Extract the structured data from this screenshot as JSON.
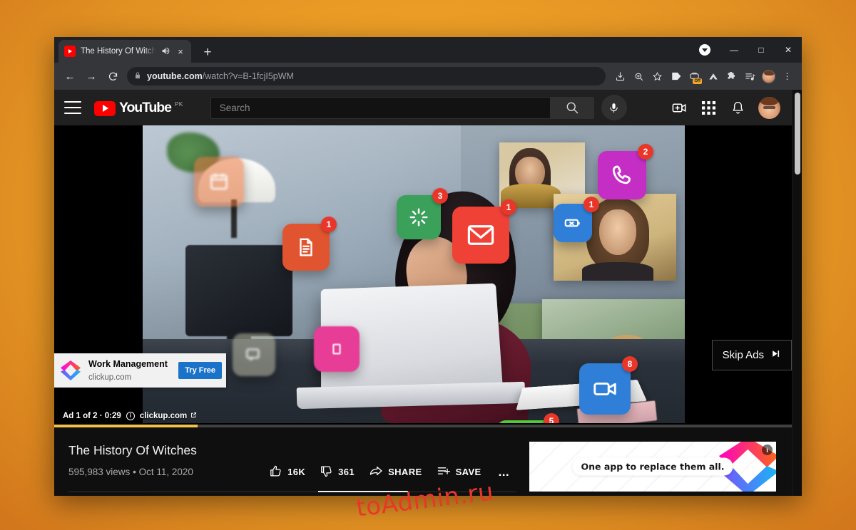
{
  "browser": {
    "tab": {
      "title": "The History Of Witches - You",
      "favicon": "youtube-favicon",
      "mute_icon": "speaker-icon",
      "close_icon": "×"
    },
    "new_tab_label": "+",
    "window_controls": {
      "minimize": "—",
      "maximize": "□",
      "close": "✕"
    },
    "update_indicator": "update-arrow",
    "nav": {
      "back": "←",
      "forward": "→",
      "reload": "⟳"
    },
    "omnibox": {
      "lock_icon": "lock-icon",
      "url_domain": "youtube.com",
      "url_path": "/watch?v=B-1fcjI5pWM"
    },
    "toolbar_icons": [
      "install-app-icon",
      "zoom-icon",
      "bookmark-star-icon",
      "tag-extension-icon",
      "adblock-off-icon",
      "nordvpn-icon",
      "puzzle-extensions-icon",
      "playlist-icon",
      "profile-avatar"
    ],
    "overflow_menu": "⋮"
  },
  "youtube": {
    "masthead": {
      "menu_icon": "hamburger-icon",
      "logo_word": "YouTube",
      "logo_country": "PK",
      "search_placeholder": "Search",
      "search_icon": "search-icon",
      "mic_icon": "microphone-icon",
      "create_icon": "create-video-icon",
      "apps_icon": "youtube-apps-icon",
      "notifications_icon": "bell-icon",
      "avatar": "account-avatar"
    },
    "player": {
      "ad_overlay": {
        "logo": "clickup-logo",
        "title": "Work Management",
        "host": "clickup.com",
        "cta": "Try Free"
      },
      "skip_button": {
        "label": "Skip Ads",
        "icon": "skip-next-icon"
      },
      "ad_status": {
        "text": "Ad 1 of 2 · 0:29",
        "info_icon": "i",
        "visit_label": "clickup.com",
        "external_icon": "↗"
      },
      "progress_percent": 19,
      "progress_color": "#f2c14b"
    },
    "video": {
      "title": "The History Of Witches",
      "views": "595,983 views",
      "separator": "•",
      "date": "Oct 11, 2020",
      "actions": [
        {
          "name": "like",
          "icon": "thumbs-up-icon",
          "label": "16K"
        },
        {
          "name": "dislike",
          "icon": "thumbs-down-icon",
          "label": "361"
        },
        {
          "name": "share",
          "icon": "share-arrow-icon",
          "label": "SHARE"
        },
        {
          "name": "save",
          "icon": "save-playlist-icon",
          "label": "SAVE"
        },
        {
          "name": "more",
          "icon": "more-horizontal-icon",
          "label": "..."
        }
      ]
    },
    "sidebar_ad": {
      "headline": "One app to replace them all.",
      "logo": "clickup-logo",
      "info_badge": "i"
    }
  },
  "notification_bubbles": [
    {
      "name": "calendar",
      "count": "",
      "color": "#e9763e"
    },
    {
      "name": "document",
      "count": "1",
      "color": "#e0542f"
    },
    {
      "name": "loading",
      "count": "3",
      "color": "#3aa05a"
    },
    {
      "name": "mail",
      "count": "1",
      "color": "#ef4136"
    },
    {
      "name": "phone",
      "count": "2",
      "color": "#c42ec4"
    },
    {
      "name": "battery",
      "count": "1",
      "color": "#2f7fd8"
    },
    {
      "name": "video-camera",
      "count": "8",
      "color": "#2f7fd8"
    },
    {
      "name": "chat",
      "count": "5",
      "color": "#4ecb3a"
    }
  ],
  "watermark": "toAdmin.ru"
}
